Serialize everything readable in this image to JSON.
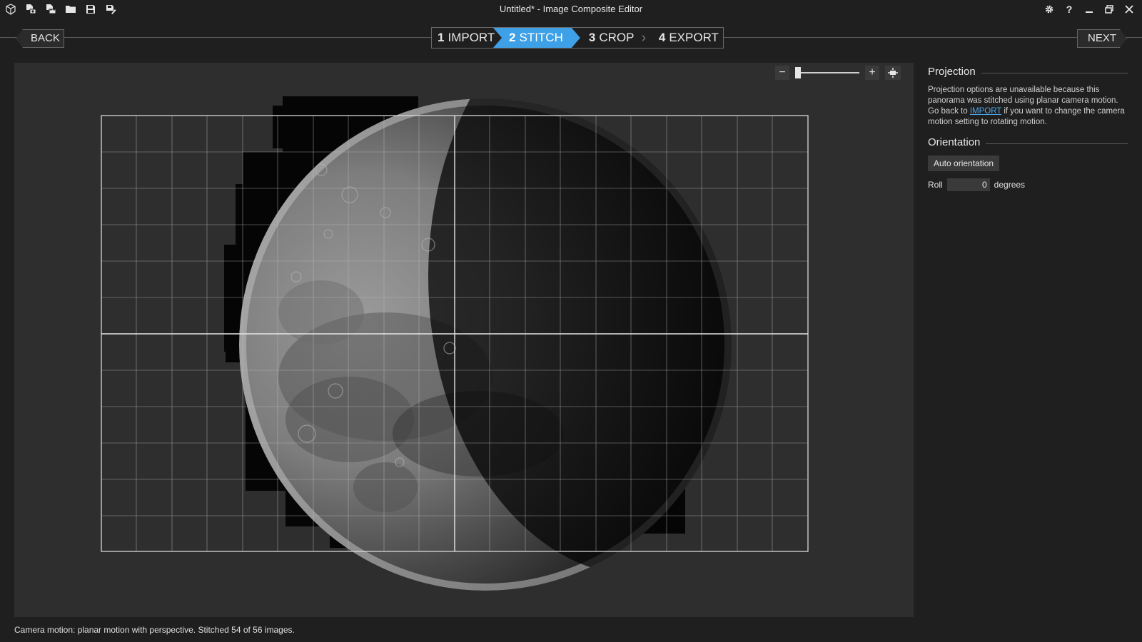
{
  "window": {
    "title": "Untitled* - Image Composite Editor"
  },
  "quick_access": [
    {
      "icon": "new-project-icon"
    },
    {
      "icon": "new-panorama-from-images-icon"
    },
    {
      "icon": "new-panorama-from-video-icon"
    },
    {
      "icon": "open-folder-icon"
    },
    {
      "icon": "save-icon"
    },
    {
      "icon": "save-as-icon"
    }
  ],
  "window_controls": [
    "gear-icon",
    "help-icon",
    "minimize-icon",
    "restore-icon",
    "close-icon"
  ],
  "nav": {
    "back_label": "BACK",
    "next_label": "NEXT",
    "steps": [
      {
        "num": "1",
        "label": "IMPORT"
      },
      {
        "num": "2",
        "label": "STITCH"
      },
      {
        "num": "3",
        "label": "CROP"
      },
      {
        "num": "4",
        "label": "EXPORT"
      }
    ],
    "active_step": "2"
  },
  "zoom": {
    "minus_label": "−",
    "plus_label": "+",
    "level": 0.0
  },
  "panel": {
    "projection": {
      "heading": "Projection",
      "text_before": "Projection options are unavailable because this panorama was stitched using planar camera motion. Go back to ",
      "link": "IMPORT",
      "text_after": " if you want to change the camera motion setting to rotating motion."
    },
    "orientation": {
      "heading": "Orientation",
      "auto_button": "Auto orientation",
      "roll_label": "Roll",
      "roll_value": "0",
      "roll_unit": "degrees"
    }
  },
  "status": "Camera motion: planar motion with perspective. Stitched 54 of 56 images.",
  "colors": {
    "accent": "#3ea0e6",
    "background": "#1f1f1f",
    "canvas": "#2e2e2e"
  }
}
